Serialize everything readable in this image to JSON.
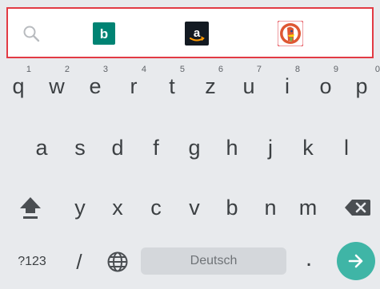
{
  "search_engines": [
    {
      "name": "search-icon",
      "label": ""
    },
    {
      "name": "bing-icon",
      "label": "b",
      "color": "#008373"
    },
    {
      "name": "amazon-icon",
      "label": "a",
      "color": "#131a22"
    },
    {
      "name": "duckduckgo-icon",
      "label": "",
      "color": "#de5833"
    },
    {
      "name": "firefox-icon",
      "label": "",
      "color": "#ff7139"
    }
  ],
  "keyboard": {
    "row1": [
      {
        "ch": "q",
        "hint": "1"
      },
      {
        "ch": "w",
        "hint": "2"
      },
      {
        "ch": "e",
        "hint": "3"
      },
      {
        "ch": "r",
        "hint": "4"
      },
      {
        "ch": "t",
        "hint": "5"
      },
      {
        "ch": "z",
        "hint": "6"
      },
      {
        "ch": "u",
        "hint": "7"
      },
      {
        "ch": "i",
        "hint": "8"
      },
      {
        "ch": "o",
        "hint": "9"
      },
      {
        "ch": "p",
        "hint": "0"
      }
    ],
    "row2": [
      "a",
      "s",
      "d",
      "f",
      "g",
      "h",
      "j",
      "k",
      "l"
    ],
    "row3": [
      "y",
      "x",
      "c",
      "v",
      "b",
      "n",
      "m"
    ],
    "symbols_label": "?123",
    "slash_label": "/",
    "space_label": "Deutsch",
    "period_label": ".",
    "icons": {
      "shift": "shift-icon",
      "backspace": "backspace-icon",
      "globe": "globe-icon",
      "enter": "arrow-right-icon"
    },
    "accent_color": "#3fb5a6"
  }
}
